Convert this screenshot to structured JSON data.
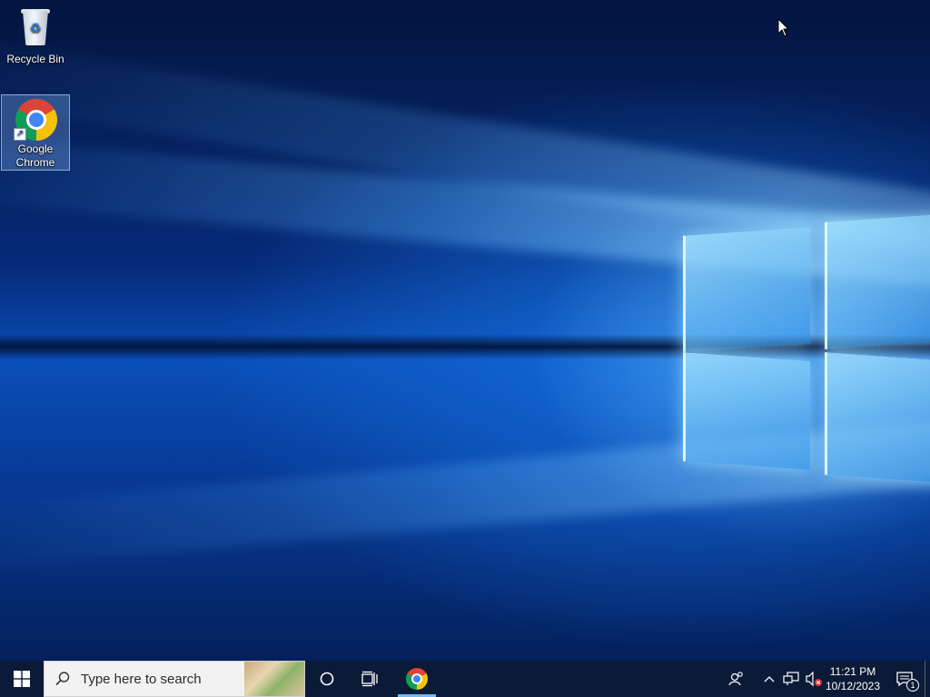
{
  "desktop": {
    "icons": [
      {
        "label": "Recycle Bin",
        "icon": "recycle-bin-icon"
      },
      {
        "label": "Google\nChrome",
        "label_line1": "Google",
        "label_line2": "Chrome",
        "icon": "chrome-icon",
        "selected": true
      }
    ]
  },
  "taskbar": {
    "start_icon": "windows-start-icon",
    "search": {
      "placeholder": "Type here to search",
      "icon": "search-icon"
    },
    "cortana_icon": "cortana-circle-icon",
    "task_view_icon": "task-view-icon",
    "pinned_apps": [
      {
        "name": "Google Chrome",
        "icon": "chrome-icon",
        "active": true
      }
    ],
    "tray": {
      "people_icon": "people-icon",
      "chevron_icon": "chevron-up-icon",
      "network_icon": "network-icon",
      "volume_icon": "volume-muted-icon",
      "time": "11:21 PM",
      "date": "10/12/2023",
      "notifications_icon": "action-center-icon",
      "notifications_count": "1"
    }
  },
  "colors": {
    "taskbar_bg": "#0b1a36",
    "accent": "#76b9ed",
    "wallpaper_blue": "#0a4fb8"
  }
}
